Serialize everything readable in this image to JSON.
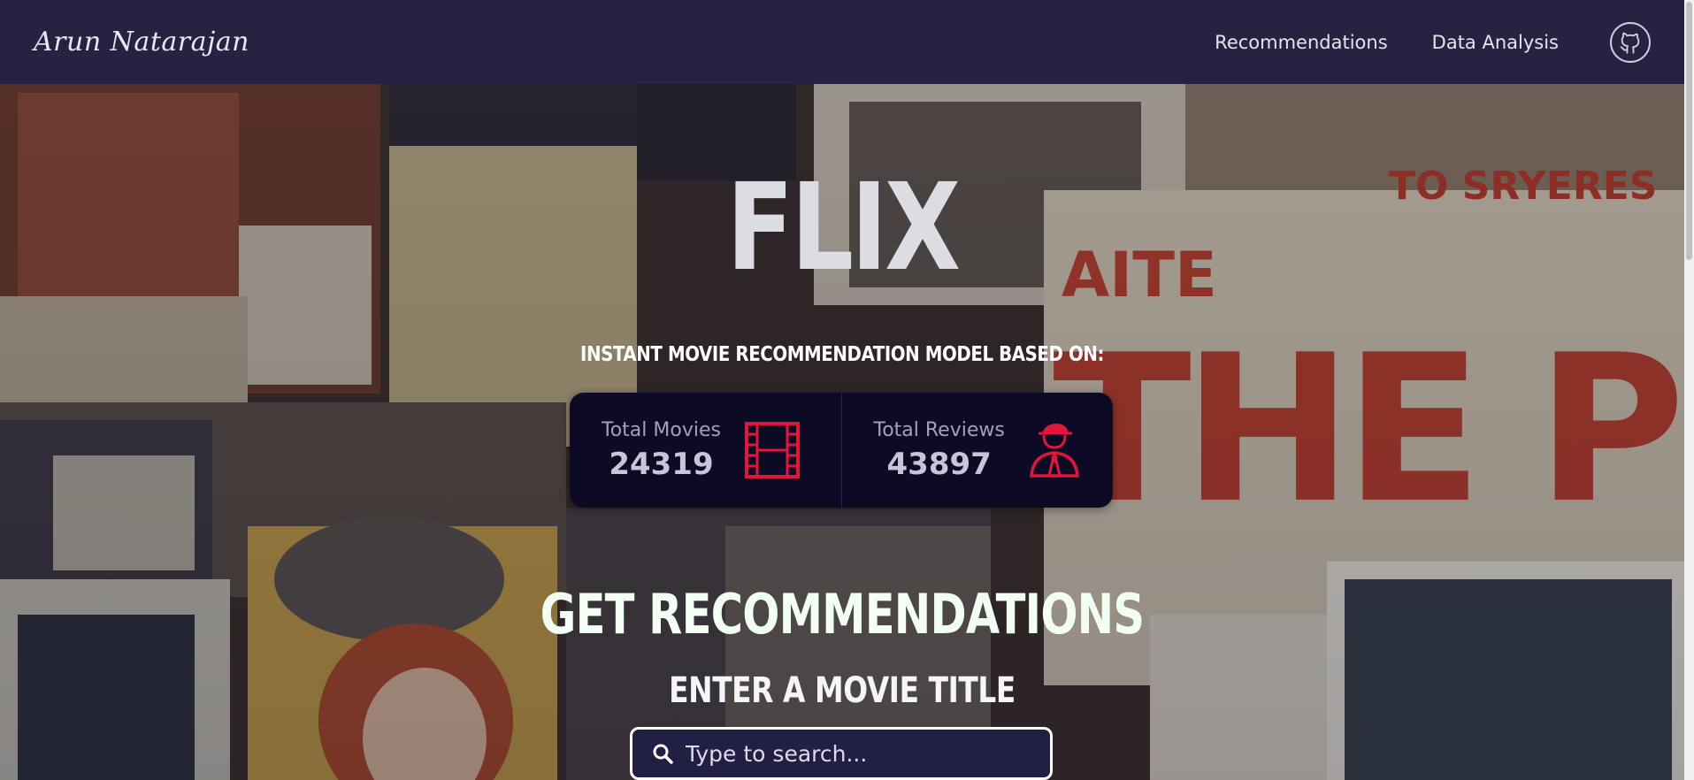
{
  "nav": {
    "brand": "Arun Natarajan",
    "links": [
      "Recommendations",
      "Data Analysis"
    ],
    "github_icon": "github-icon"
  },
  "hero": {
    "title": "FLIX",
    "subtitle": "INSTANT MOVIE RECOMMENDATION MODEL BASED ON:",
    "stats": [
      {
        "label": "Total Movies",
        "value": "24319",
        "icon": "film-icon"
      },
      {
        "label": "Total Reviews",
        "value": "43897",
        "icon": "reviewer-icon"
      }
    ],
    "heading": "GET RECOMMENDATIONS",
    "prompt": "ENTER A MOVIE TITLE",
    "search": {
      "placeholder": "Type to search...",
      "value": "",
      "icon": "search-icon"
    }
  },
  "colors": {
    "navbar": "#262241",
    "stats_bg": "#0c0a25",
    "accent_red": "#e0163a",
    "search_bg": "#221f44"
  }
}
